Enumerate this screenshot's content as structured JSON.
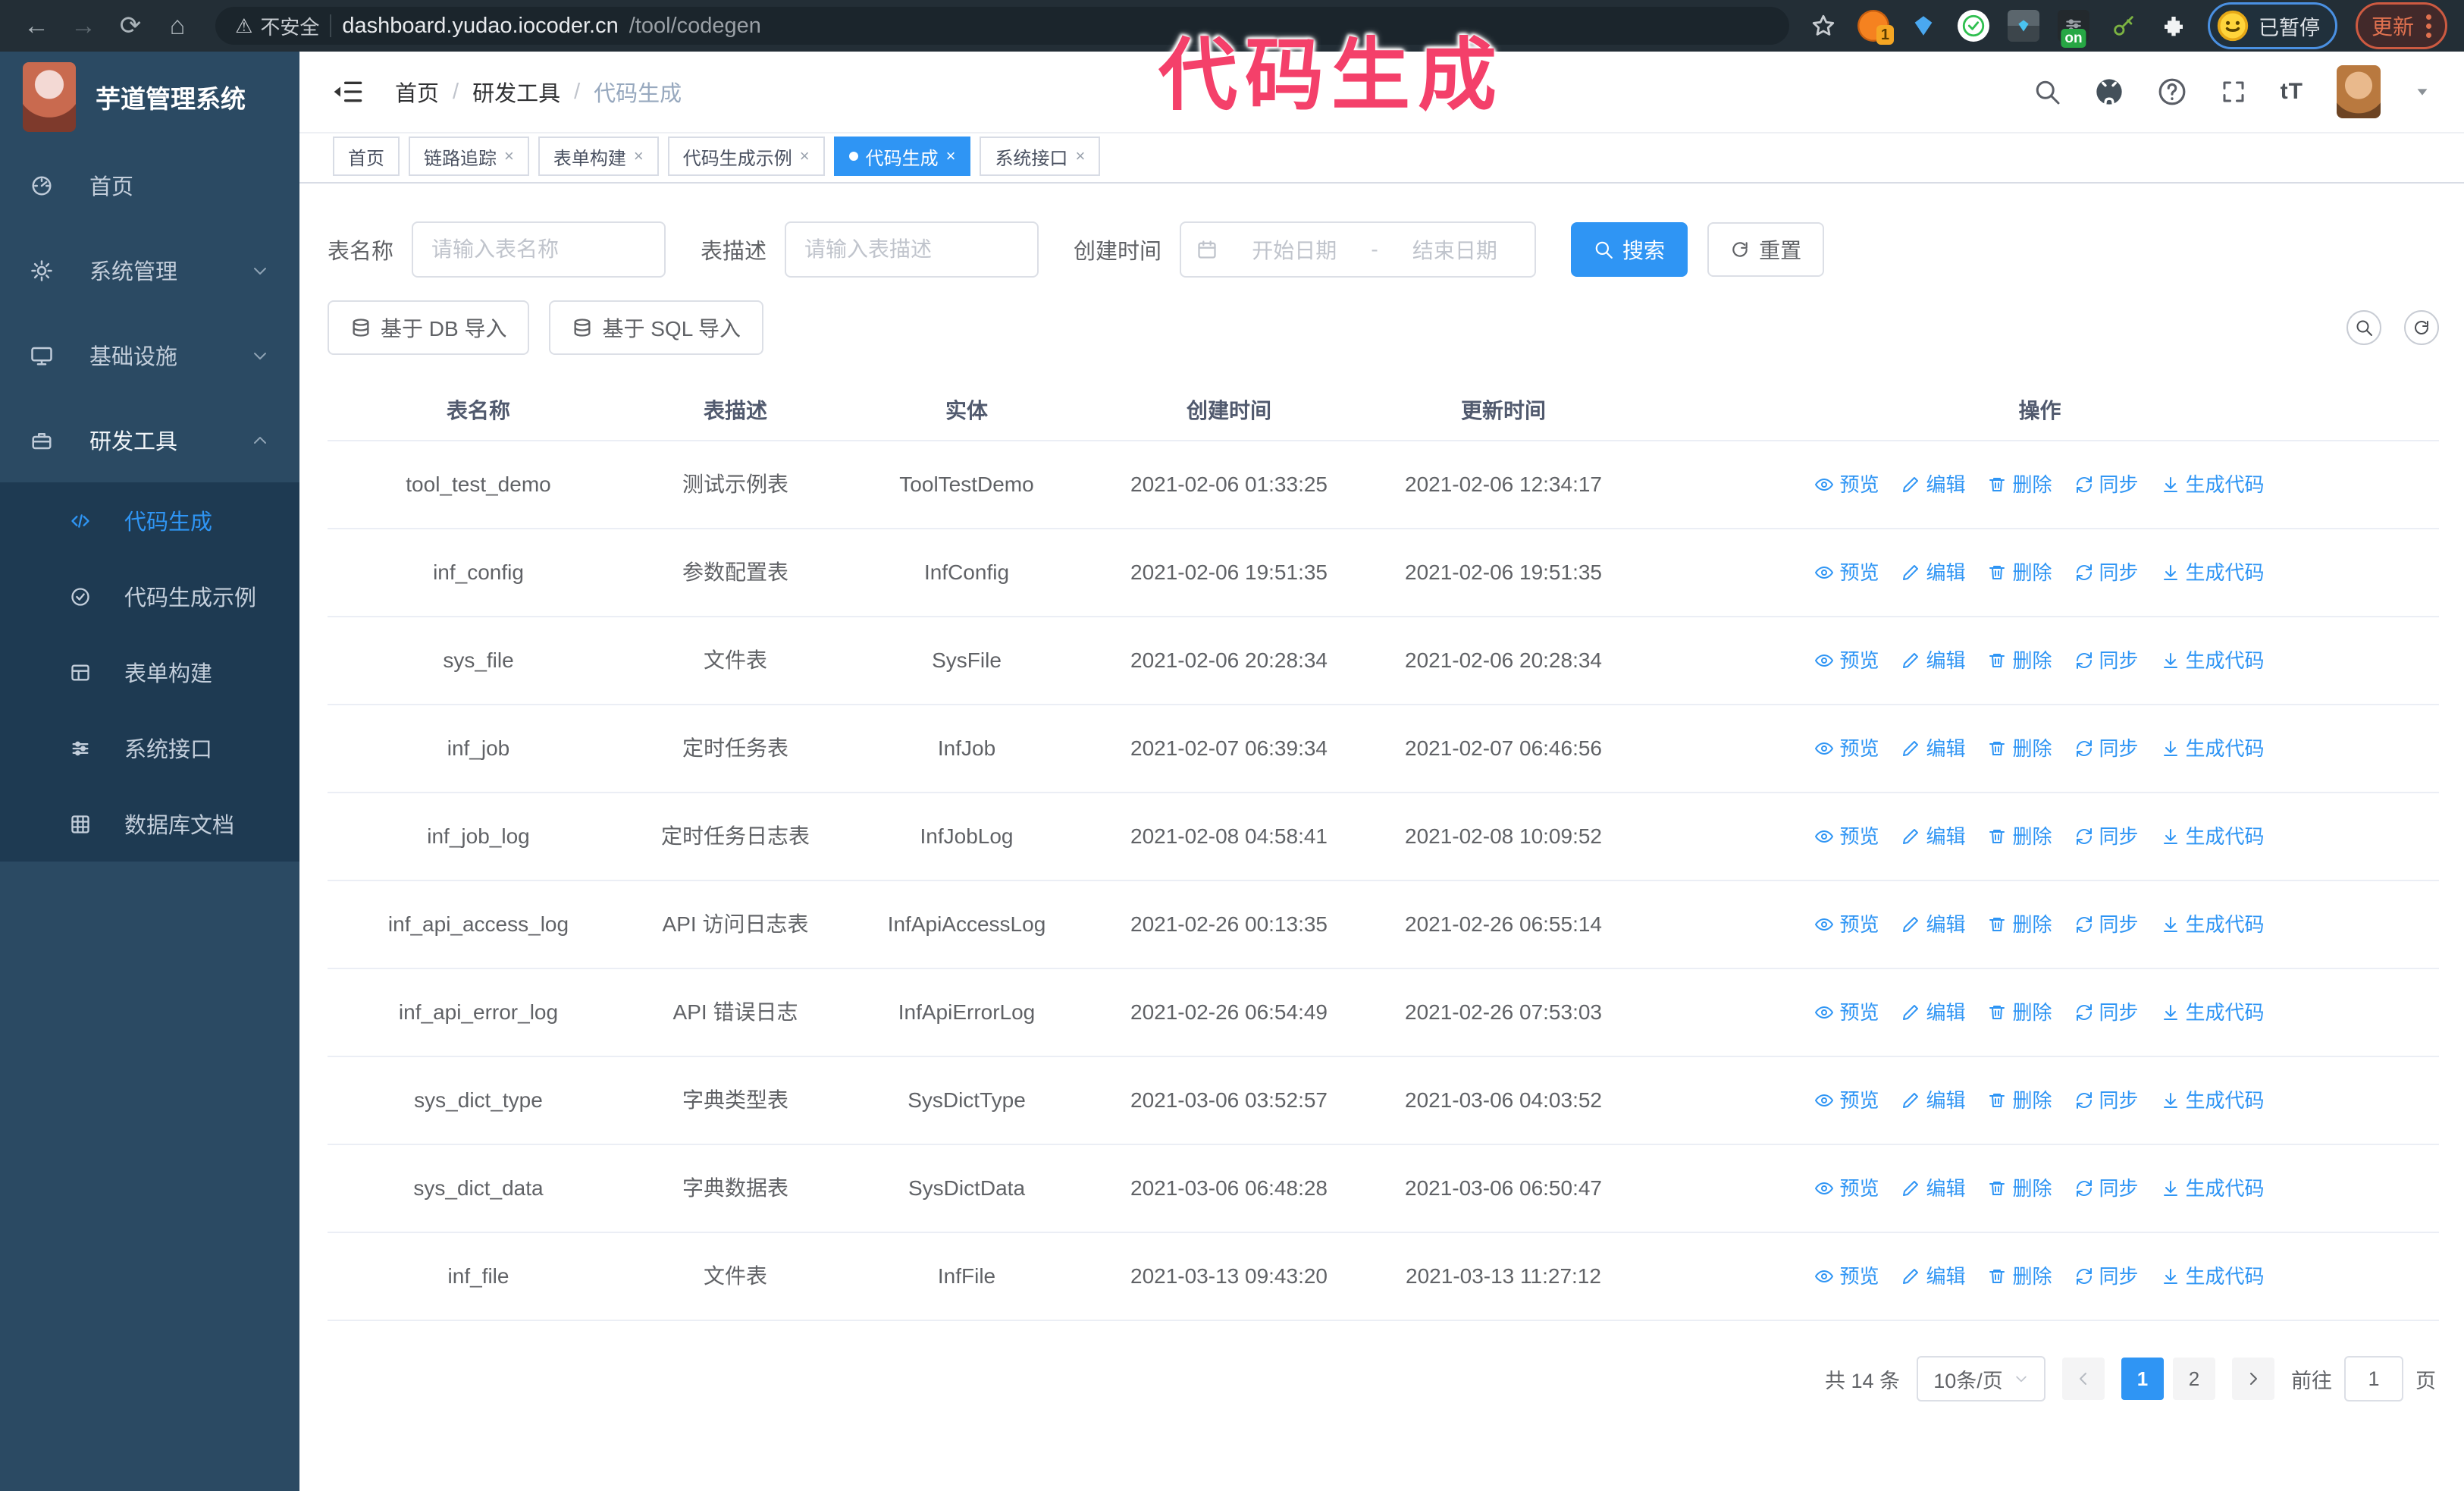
{
  "colors": {
    "primary": "#2f95f4",
    "sidebar_bg": "#2b4a63",
    "submenu_bg": "#1e3a52",
    "annotation": "#f4406a"
  },
  "browser": {
    "security_label": "不安全",
    "url_host": "dashboard.yudao.iocoder.cn",
    "url_path": "/tool/codegen",
    "extension_badge": "1",
    "extension_on_badge": "on",
    "paused_label": "已暂停",
    "update_label": "更新"
  },
  "annotation": {
    "text": "代码生成"
  },
  "sidebar": {
    "title": "芋道管理系统",
    "items": [
      {
        "label": "首页",
        "icon": "dashboard",
        "children": null,
        "expanded": false,
        "active": false
      },
      {
        "label": "系统管理",
        "icon": "gear",
        "children": [],
        "expanded": false,
        "active": false
      },
      {
        "label": "基础设施",
        "icon": "monitor",
        "children": [],
        "expanded": false,
        "active": false
      },
      {
        "label": "研发工具",
        "icon": "toolbox",
        "expanded": true,
        "active": true,
        "children": [
          {
            "label": "代码生成",
            "icon": "code",
            "active": true
          },
          {
            "label": "代码生成示例",
            "icon": "example",
            "active": false
          },
          {
            "label": "表单构建",
            "icon": "form",
            "active": false
          },
          {
            "label": "系统接口",
            "icon": "api",
            "active": false
          },
          {
            "label": "数据库文档",
            "icon": "dbdoc",
            "active": false
          }
        ]
      }
    ]
  },
  "breadcrumb": {
    "items": [
      "首页",
      "研发工具",
      "代码生成"
    ],
    "separator": "/"
  },
  "tabs": [
    {
      "label": "首页",
      "closable": false,
      "active": false
    },
    {
      "label": "链路追踪",
      "closable": true,
      "active": false
    },
    {
      "label": "表单构建",
      "closable": true,
      "active": false
    },
    {
      "label": "代码生成示例",
      "closable": true,
      "active": false
    },
    {
      "label": "代码生成",
      "closable": true,
      "active": true
    },
    {
      "label": "系统接口",
      "closable": true,
      "active": false
    }
  ],
  "filters": {
    "table_name_label": "表名称",
    "table_name_placeholder": "请输入表名称",
    "table_desc_label": "表描述",
    "table_desc_placeholder": "请输入表描述",
    "create_time_label": "创建时间",
    "date_start_placeholder": "开始日期",
    "date_separator": "-",
    "date_end_placeholder": "结束日期",
    "search_label": "搜索",
    "reset_label": "重置"
  },
  "toolbar": {
    "import_db_label": "基于 DB 导入",
    "import_sql_label": "基于 SQL 导入"
  },
  "table": {
    "columns": [
      "表名称",
      "表描述",
      "实体",
      "创建时间",
      "更新时间",
      "操作"
    ],
    "actions": [
      {
        "label": "预览",
        "icon": "eye"
      },
      {
        "label": "编辑",
        "icon": "edit"
      },
      {
        "label": "删除",
        "icon": "trash"
      },
      {
        "label": "同步",
        "icon": "sync"
      },
      {
        "label": "生成代码",
        "icon": "download"
      }
    ],
    "rows": [
      {
        "name": "tool_test_demo",
        "desc": "测试示例表",
        "entity": "ToolTestDemo",
        "created": "2021-02-06 01:33:25",
        "updated": "2021-02-06 12:34:17"
      },
      {
        "name": "inf_config",
        "desc": "参数配置表",
        "entity": "InfConfig",
        "created": "2021-02-06 19:51:35",
        "updated": "2021-02-06 19:51:35"
      },
      {
        "name": "sys_file",
        "desc": "文件表",
        "entity": "SysFile",
        "created": "2021-02-06 20:28:34",
        "updated": "2021-02-06 20:28:34"
      },
      {
        "name": "inf_job",
        "desc": "定时任务表",
        "entity": "InfJob",
        "created": "2021-02-07 06:39:34",
        "updated": "2021-02-07 06:46:56"
      },
      {
        "name": "inf_job_log",
        "desc": "定时任务日志表",
        "entity": "InfJobLog",
        "created": "2021-02-08 04:58:41",
        "updated": "2021-02-08 10:09:52"
      },
      {
        "name": "inf_api_access_log",
        "desc": "API 访问日志表",
        "entity": "InfApiAccessLog",
        "created": "2021-02-26 00:13:35",
        "updated": "2021-02-26 06:55:14"
      },
      {
        "name": "inf_api_error_log",
        "desc": "API 错误日志",
        "entity": "InfApiErrorLog",
        "created": "2021-02-26 06:54:49",
        "updated": "2021-02-26 07:53:03"
      },
      {
        "name": "sys_dict_type",
        "desc": "字典类型表",
        "entity": "SysDictType",
        "created": "2021-03-06 03:52:57",
        "updated": "2021-03-06 04:03:52"
      },
      {
        "name": "sys_dict_data",
        "desc": "字典数据表",
        "entity": "SysDictData",
        "created": "2021-03-06 06:48:28",
        "updated": "2021-03-06 06:50:47"
      },
      {
        "name": "inf_file",
        "desc": "文件表",
        "entity": "InfFile",
        "created": "2021-03-13 09:43:20",
        "updated": "2021-03-13 11:27:12"
      }
    ]
  },
  "pagination": {
    "total_label": "共 14 条",
    "page_size_label": "10条/页",
    "pages": [
      "1",
      "2"
    ],
    "active_page": "1",
    "goto_label": "前往",
    "goto_value": "1",
    "goto_suffix": "页"
  }
}
